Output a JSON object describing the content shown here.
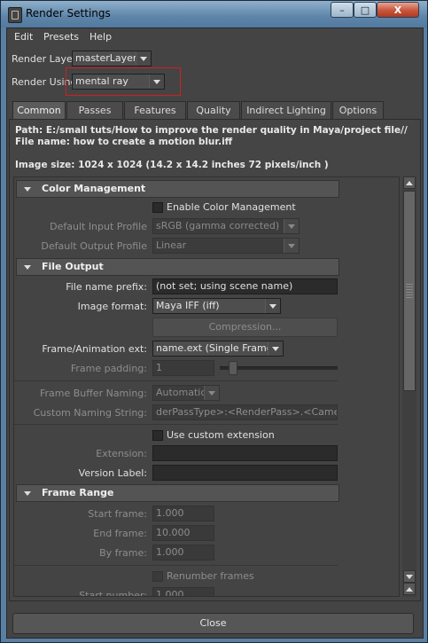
{
  "window": {
    "title": "Render Settings",
    "controls": {
      "minimize": "–",
      "maximize": "□",
      "close": "X"
    }
  },
  "menu": [
    "Edit",
    "Presets",
    "Help"
  ],
  "render_layer": {
    "label": "Render Layer",
    "value": "masterLayer"
  },
  "render_using": {
    "label": "Render Using",
    "value": "mental ray"
  },
  "tabs": [
    "Common",
    "Passes",
    "Features",
    "Quality",
    "Indirect Lighting",
    "Options"
  ],
  "active_tab": "Common",
  "info": {
    "path": "Path: E:/small tuts/How to improve the render quality in Maya/project file//",
    "file_name": "File name:  how to create a motion blur.iff",
    "image_size": "Image size: 1024 x 1024 (14.2 x 14.2 inches 72 pixels/inch )"
  },
  "color_management": {
    "title": "Color Management",
    "enable_label": "Enable Color Management",
    "input_profile_label": "Default Input Profile",
    "input_profile_value": "sRGB (gamma corrected)",
    "output_profile_label": "Default Output Profile",
    "output_profile_value": "Linear"
  },
  "file_output": {
    "title": "File Output",
    "prefix_label": "File name prefix:",
    "prefix_value": "(not set; using scene name)",
    "format_label": "Image format:",
    "format_value": "Maya IFF (iff)",
    "compression_label": "Compression...",
    "ext_label": "Frame/Animation ext:",
    "ext_value": "name.ext (Single Frame)",
    "padding_label": "Frame padding:",
    "padding_value": "1",
    "buffer_naming_label": "Frame Buffer Naming:",
    "buffer_naming_value": "Automatic",
    "custom_naming_label": "Custom Naming String:",
    "custom_naming_value": "derPassType>:<RenderPass>.<Camera>",
    "custom_ext_label": "Use custom extension",
    "extension_label": "Extension:",
    "extension_value": "",
    "version_label": "Version Label:",
    "version_value": ""
  },
  "frame_range": {
    "title": "Frame Range",
    "start_label": "Start frame:",
    "start_value": "1.000",
    "end_label": "End frame:",
    "end_value": "10.000",
    "by_label": "By frame:",
    "by_value": "1.000",
    "renumber_label": "Renumber frames",
    "start_number_label": "Start number:",
    "start_number_value": "1.000"
  },
  "close_button": "Close"
}
